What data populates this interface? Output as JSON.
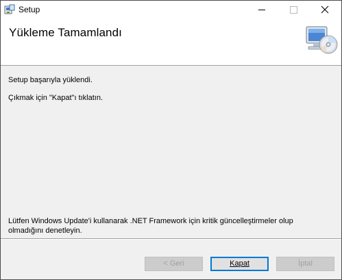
{
  "window": {
    "title": "Setup",
    "icons": {
      "app": "setup-installer-icon",
      "minimize": "minimize-icon",
      "maximize": "maximize-icon",
      "close": "close-icon"
    }
  },
  "header": {
    "title": "Yükleme Tamamlandı",
    "icon": "computer-cd-icon"
  },
  "content": {
    "message1": "Setup başarıyla yüklendi.",
    "message2": "Çıkmak için \"Kapat\"ı tıklatın.",
    "note": "Lütfen Windows Update'i kullanarak .NET Framework için kritik güncelleştirmeler olup olmadığını denetleyin."
  },
  "buttons": {
    "back": {
      "label": "< Geri",
      "enabled": false
    },
    "close": {
      "label": "Kapat",
      "enabled": true,
      "default": true
    },
    "cancel": {
      "label": "İptal",
      "enabled": false
    }
  }
}
